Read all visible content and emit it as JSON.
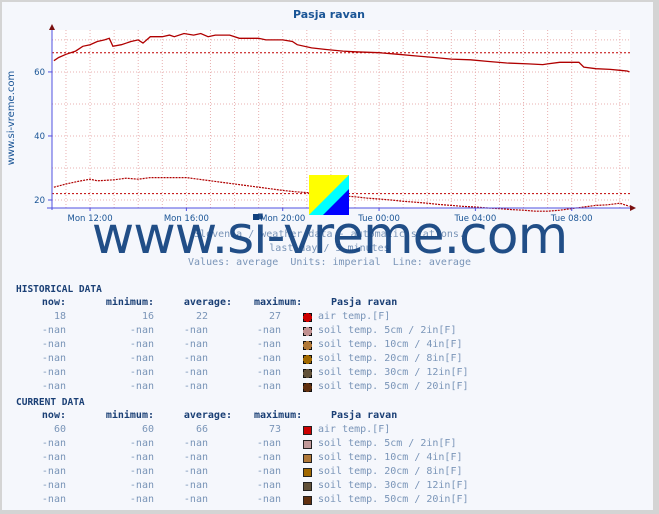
{
  "chart_data": {
    "type": "line",
    "title": "Pasja ravan",
    "side_label": "www.si-vreme.com",
    "ylim": [
      17.5,
      73.1
    ],
    "yticks": [
      20,
      40,
      60
    ],
    "ygrid": [
      20,
      30,
      40,
      50,
      60,
      70
    ],
    "x_range_hours": [
      -1.58,
      22.42
    ],
    "xticks": [
      {
        "label": "Mon 12:00",
        "hour": 0
      },
      {
        "label": "Mon 16:00",
        "hour": 4
      },
      {
        "label": "Mon 20:00",
        "hour": 8
      },
      {
        "label": "Tue 00:00",
        "hour": 12
      },
      {
        "label": "Tue 04:00",
        "hour": 16
      },
      {
        "label": "Tue 08:00",
        "hour": 20
      }
    ],
    "grid": true,
    "series": [
      {
        "name": "air temp.[F] (current)",
        "style": "solid",
        "color": "#b00000",
        "points": [
          [
            -1.5,
            63.5
          ],
          [
            -1.3,
            64.5
          ],
          [
            -1.0,
            65.5
          ],
          [
            -0.6,
            66.5
          ],
          [
            -0.3,
            68.0
          ],
          [
            0.0,
            68.5
          ],
          [
            0.3,
            69.5
          ],
          [
            0.6,
            70.0
          ],
          [
            0.8,
            70.5
          ],
          [
            0.95,
            68.0
          ],
          [
            1.3,
            68.5
          ],
          [
            1.7,
            69.5
          ],
          [
            2.0,
            70.0
          ],
          [
            2.2,
            69.0
          ],
          [
            2.5,
            71.0
          ],
          [
            3.0,
            71.0
          ],
          [
            3.3,
            71.5
          ],
          [
            3.5,
            71.0
          ],
          [
            3.9,
            72.0
          ],
          [
            4.3,
            71.5
          ],
          [
            4.6,
            72.0
          ],
          [
            4.9,
            71.0
          ],
          [
            5.2,
            71.5
          ],
          [
            5.8,
            71.5
          ],
          [
            6.2,
            70.5
          ],
          [
            7.0,
            70.5
          ],
          [
            7.3,
            70.0
          ],
          [
            8.0,
            70.0
          ],
          [
            8.4,
            69.5
          ],
          [
            8.6,
            68.5
          ],
          [
            9.2,
            67.5
          ],
          [
            9.8,
            67.0
          ],
          [
            10.5,
            66.5
          ],
          [
            11.0,
            66.3
          ],
          [
            12.0,
            66.0
          ],
          [
            12.8,
            65.5
          ],
          [
            13.5,
            65.0
          ],
          [
            14.3,
            64.5
          ],
          [
            15.0,
            64.0
          ],
          [
            15.8,
            63.8
          ],
          [
            16.5,
            63.3
          ],
          [
            17.3,
            62.8
          ],
          [
            18.2,
            62.5
          ],
          [
            18.8,
            62.3
          ],
          [
            19.0,
            62.5
          ],
          [
            19.5,
            63.0
          ],
          [
            20.3,
            63.0
          ],
          [
            20.5,
            61.5
          ],
          [
            21.0,
            61.0
          ],
          [
            21.6,
            60.8
          ],
          [
            22.0,
            60.5
          ],
          [
            22.3,
            60.3
          ],
          [
            22.4,
            60.0
          ]
        ]
      },
      {
        "name": "air temp.[F] (historical)",
        "style": "dotted",
        "color": "#b00000",
        "points": [
          [
            -1.5,
            24.0
          ],
          [
            -1.0,
            25.0
          ],
          [
            -0.5,
            25.8
          ],
          [
            0.0,
            26.5
          ],
          [
            0.3,
            26.0
          ],
          [
            1.0,
            26.3
          ],
          [
            1.5,
            26.8
          ],
          [
            2.0,
            26.5
          ],
          [
            2.5,
            27.0
          ],
          [
            3.0,
            27.0
          ],
          [
            3.5,
            27.0
          ],
          [
            4.0,
            27.0
          ],
          [
            4.5,
            26.5
          ],
          [
            5.0,
            26.0
          ],
          [
            5.5,
            25.5
          ],
          [
            6.0,
            25.0
          ],
          [
            6.5,
            24.5
          ],
          [
            7.0,
            24.0
          ],
          [
            7.5,
            23.5
          ],
          [
            8.0,
            23.0
          ],
          [
            8.5,
            22.6
          ],
          [
            9.0,
            22.3
          ],
          [
            9.5,
            22.0
          ],
          [
            10.0,
            21.7
          ],
          [
            10.5,
            21.3
          ],
          [
            11.0,
            21.0
          ],
          [
            11.5,
            20.6
          ],
          [
            12.0,
            20.3
          ],
          [
            12.5,
            20.0
          ],
          [
            13.0,
            19.6
          ],
          [
            13.5,
            19.3
          ],
          [
            14.0,
            19.0
          ],
          [
            14.5,
            18.6
          ],
          [
            15.0,
            18.3
          ],
          [
            15.5,
            18.0
          ],
          [
            16.0,
            17.8
          ],
          [
            16.5,
            17.5
          ],
          [
            17.0,
            17.3
          ],
          [
            17.5,
            17.0
          ],
          [
            18.0,
            16.8
          ],
          [
            18.5,
            16.5
          ],
          [
            19.0,
            16.5
          ],
          [
            19.5,
            16.8
          ],
          [
            20.0,
            17.3
          ],
          [
            20.5,
            17.8
          ],
          [
            21.0,
            18.3
          ],
          [
            21.5,
            18.5
          ],
          [
            22.0,
            19.0
          ],
          [
            22.4,
            18.0
          ]
        ]
      }
    ],
    "reference_lines": [
      {
        "name": "current average",
        "value": 66,
        "style": "dashed"
      },
      {
        "name": "historical average",
        "value": 22,
        "style": "dashed"
      }
    ]
  },
  "subtitle": {
    "line1": "Slovenia / weather data - automatic stations.",
    "line2": "last day / 5 minutes",
    "line3": "Values: average  Units: imperial  Line: average"
  },
  "watermark": "www.si-vreme.com",
  "historical": {
    "title": "HISTORICAL DATA",
    "headers": {
      "now": "now:",
      "min": "minimum:",
      "avg": "average:",
      "max": "maximum:",
      "station": "Pasja ravan"
    },
    "rows": [
      {
        "now": "18",
        "min": "16",
        "avg": "22",
        "max": "27",
        "color": "#cc0000",
        "label": "air temp.[F]"
      },
      {
        "now": "-nan",
        "min": "-nan",
        "avg": "-nan",
        "max": "-nan",
        "color": "#c09090",
        "label": "soil temp. 5cm / 2in[F]"
      },
      {
        "now": "-nan",
        "min": "-nan",
        "avg": "-nan",
        "max": "-nan",
        "color": "#b07838",
        "label": "soil temp. 10cm / 4in[F]"
      },
      {
        "now": "-nan",
        "min": "-nan",
        "avg": "-nan",
        "max": "-nan",
        "color": "#a06800",
        "label": "soil temp. 20cm / 8in[F]"
      },
      {
        "now": "-nan",
        "min": "-nan",
        "avg": "-nan",
        "max": "-nan",
        "color": "#605038",
        "label": "soil temp. 30cm / 12in[F]"
      },
      {
        "now": "-nan",
        "min": "-nan",
        "avg": "-nan",
        "max": "-nan",
        "color": "#603010",
        "label": "soil temp. 50cm / 20in[F]"
      }
    ]
  },
  "current": {
    "title": "CURRENT DATA",
    "headers": {
      "now": "now:",
      "min": "minimum:",
      "avg": "average:",
      "max": "maximum:",
      "station": "Pasja ravan"
    },
    "rows": [
      {
        "now": "60",
        "min": "60",
        "avg": "66",
        "max": "73",
        "color": "#cc0000",
        "label": "air temp.[F]"
      },
      {
        "now": "-nan",
        "min": "-nan",
        "avg": "-nan",
        "max": "-nan",
        "color": "#c09898",
        "label": "soil temp. 5cm / 2in[F]"
      },
      {
        "now": "-nan",
        "min": "-nan",
        "avg": "-nan",
        "max": "-nan",
        "color": "#b07838",
        "label": "soil temp. 10cm / 4in[F]"
      },
      {
        "now": "-nan",
        "min": "-nan",
        "avg": "-nan",
        "max": "-nan",
        "color": "#a06800",
        "label": "soil temp. 20cm / 8in[F]"
      },
      {
        "now": "-nan",
        "min": "-nan",
        "avg": "-nan",
        "max": "-nan",
        "color": "#605038",
        "label": "soil temp. 30cm / 12in[F]"
      },
      {
        "now": "-nan",
        "min": "-nan",
        "avg": "-nan",
        "max": "-nan",
        "color": "#603010",
        "label": "soil temp. 50cm / 20in[F]"
      }
    ]
  }
}
